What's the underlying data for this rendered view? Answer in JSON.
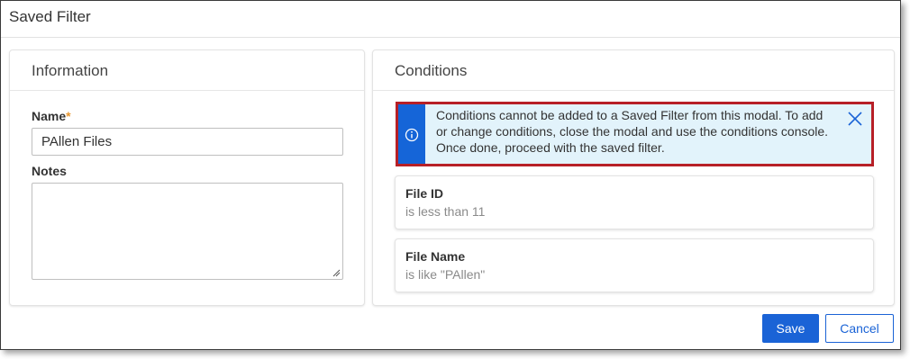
{
  "modal": {
    "title": "Saved Filter"
  },
  "information": {
    "title": "Information",
    "name_label": "Name",
    "required_mark": "*",
    "name_value": "PAllen Files",
    "notes_label": "Notes",
    "notes_value": ""
  },
  "conditions": {
    "title": "Conditions",
    "alert": {
      "icon": "info-icon",
      "text": "Conditions cannot be added to a Saved Filter from this modal. To add or change conditions, close the modal and use the conditions console. Once done, proceed with the saved filter.",
      "close_icon": "close-icon"
    },
    "items": [
      {
        "field": "File ID",
        "operator": "is less than 11"
      },
      {
        "field": "File Name",
        "operator": "is like \"PAllen\""
      }
    ]
  },
  "footer": {
    "save_label": "Save",
    "cancel_label": "Cancel"
  },
  "colors": {
    "primary": "#1a63d6",
    "alert_background": "#e2f3fb",
    "alert_stripe": "#1565d8",
    "highlight_border": "#b72027",
    "required_mark": "#e8962e"
  }
}
